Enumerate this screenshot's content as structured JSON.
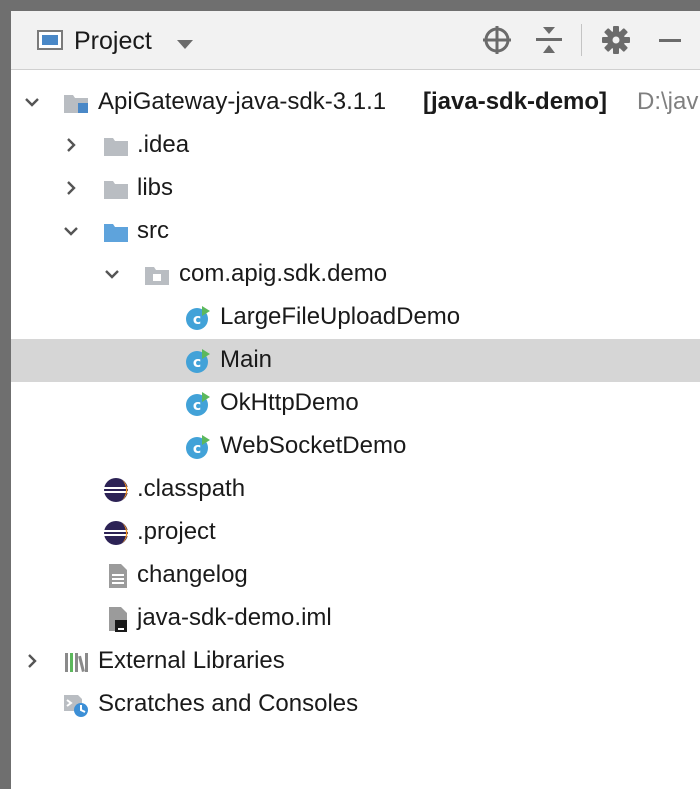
{
  "panel": {
    "title": "Project",
    "icons": [
      "project-icon",
      "dropdown-caret-icon",
      "locate-icon",
      "collapse-all-icon",
      "gear-icon",
      "minimize-icon"
    ]
  },
  "tree": {
    "root": {
      "name": "ApiGateway-java-sdk-3.1.1",
      "module": "[java-sdk-demo]",
      "path": "D:\\jav"
    },
    "items": {
      "idea": ".idea",
      "libs": "libs",
      "src": "src",
      "package": "com.apig.sdk.demo",
      "class1": "LargeFileUploadDemo",
      "class2": "Main",
      "class3": "OkHttpDemo",
      "class4": "WebSocketDemo",
      "classpath": ".classpath",
      "project": ".project",
      "changelog": "changelog",
      "iml": "java-sdk-demo.iml",
      "external": "External Libraries",
      "scratches": "Scratches and Consoles"
    },
    "selected_item": "Main"
  },
  "colors": {
    "folder": "#b9bdc2",
    "source_folder": "#5ea3dc",
    "class_circle": "#42a2d8",
    "run_badge": "#5cb85c",
    "selection": "#d6d6d6",
    "eclipse": "#2c2255",
    "eclipse_accent": "#f7941e"
  }
}
